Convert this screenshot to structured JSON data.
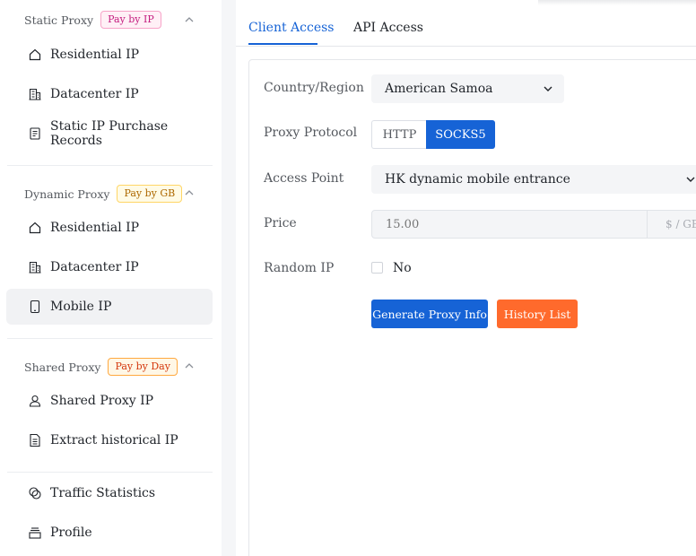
{
  "sidebar": {
    "static_proxy": {
      "title": "Static Proxy",
      "badge": "Pay by IP",
      "items": [
        {
          "label": "Residential IP",
          "icon": "home-icon"
        },
        {
          "label": "Datacenter IP",
          "icon": "building-icon"
        },
        {
          "label": "Static IP Purchase Records",
          "icon": "document-icon"
        }
      ]
    },
    "dynamic_proxy": {
      "title": "Dynamic Proxy",
      "badge": "Pay by GB",
      "items": [
        {
          "label": "Residential IP",
          "icon": "home-icon"
        },
        {
          "label": "Datacenter IP",
          "icon": "building-icon"
        },
        {
          "label": "Mobile IP",
          "icon": "mobile-icon",
          "active": true
        }
      ]
    },
    "shared_proxy": {
      "title": "Shared Proxy",
      "badge": "Pay by Day",
      "items": [
        {
          "label": "Shared Proxy IP",
          "icon": "user-icon"
        },
        {
          "label": "Extract historical IP",
          "icon": "file-icon"
        }
      ]
    },
    "bottom_items": [
      {
        "label": "Traffic Statistics",
        "icon": "chart-icon"
      },
      {
        "label": "Profile",
        "icon": "wallet-icon"
      }
    ]
  },
  "tabs": [
    {
      "label": "Client Access",
      "active": true
    },
    {
      "label": "API Access",
      "active": false
    }
  ],
  "form": {
    "country": {
      "label": "Country/Region",
      "value": "American Samoa"
    },
    "protocol": {
      "label": "Proxy Protocol",
      "options": [
        "HTTP",
        "SOCKS5"
      ],
      "selected": "SOCKS5"
    },
    "access_point": {
      "label": "Access Point",
      "value": "HK dynamic mobile entrance"
    },
    "price": {
      "label": "Price",
      "placeholder": "15.00",
      "unit": "$ / GB"
    },
    "random_ip": {
      "label": "Random IP",
      "option": "No"
    }
  },
  "buttons": {
    "generate": "Generate Proxy Info",
    "history": "History List"
  },
  "colors": {
    "primary": "#1663d6",
    "orange": "#ff6a2c"
  }
}
